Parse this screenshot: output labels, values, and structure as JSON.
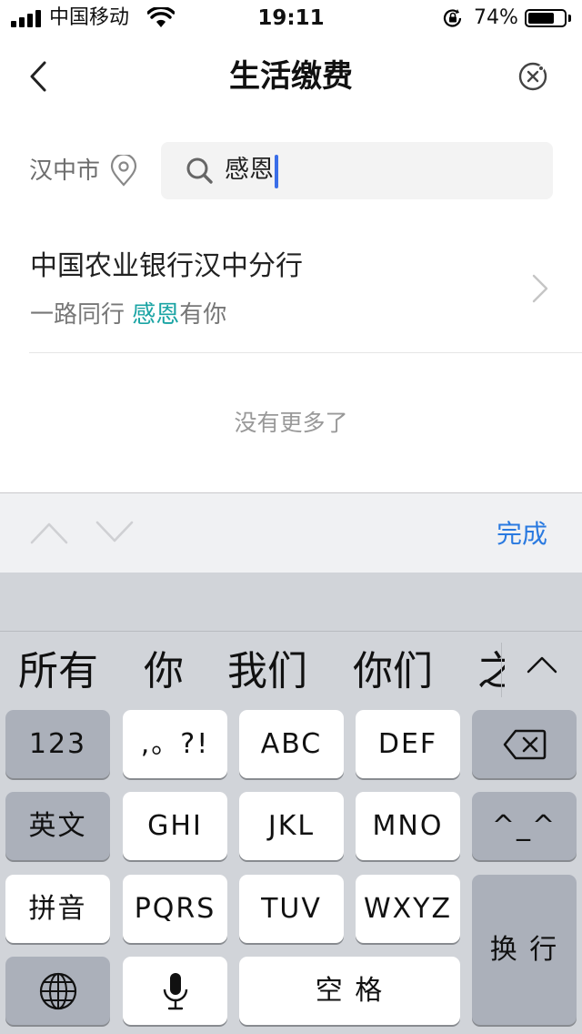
{
  "status_bar": {
    "carrier": "中国移动",
    "time": "19:11",
    "battery_percent": "74%",
    "battery_level": 0.74,
    "icons": [
      "signal-icon",
      "wifi-icon",
      "rotation-lock-icon",
      "battery-icon"
    ]
  },
  "nav": {
    "title": "生活缴费",
    "back_icon": "chevron-left-icon",
    "close_icon": "mini-program-close-icon"
  },
  "search": {
    "city": "汉中市",
    "city_icon": "location-pin-icon",
    "query": "感恩",
    "search_icon": "magnifier-icon"
  },
  "results": [
    {
      "title": "中国农业银行汉中分行",
      "subtitle_before": "一路同行 ",
      "subtitle_match": "感恩",
      "subtitle_after": "有你"
    }
  ],
  "no_more_text": "没有更多了",
  "accessory": {
    "done_label": "完成",
    "prev_icon": "chevron-up-icon",
    "next_icon": "chevron-down-icon"
  },
  "keyboard": {
    "candidates": [
      "所有",
      "你",
      "我们",
      "你们",
      "之"
    ],
    "keys": {
      "num": "123",
      "punct": ",。?!",
      "abc": "ABC",
      "def": "DEF",
      "en": "英文",
      "ghi": "GHI",
      "jkl": "JKL",
      "mno": "MNO",
      "emoji": "^_^",
      "pinyin": "拼音",
      "pqrs": "PQRS",
      "tuv": "TUV",
      "wxyz": "WXYZ",
      "return": "换 行",
      "space": "空 格"
    },
    "icons": [
      "backspace-icon",
      "globe-icon",
      "microphone-icon",
      "chevron-up-icon"
    ]
  }
}
